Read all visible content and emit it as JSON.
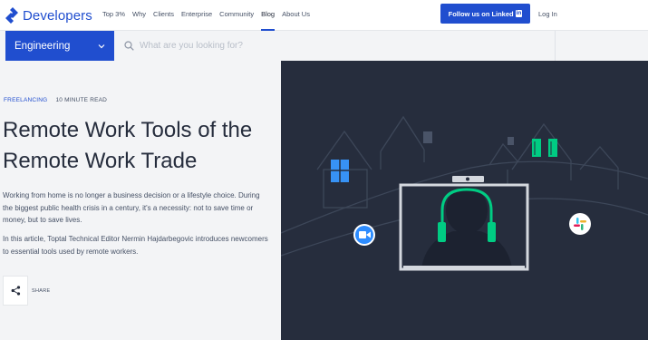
{
  "brand": {
    "name": "Developers",
    "color": "#204ecf"
  },
  "nav": {
    "links": [
      "Top 3%",
      "Why",
      "Clients",
      "Enterprise",
      "Community",
      "Blog",
      "About Us"
    ],
    "active": "Blog",
    "linkedin_label": "Follow us on",
    "linkedin_badge": "in",
    "linkedin_word": "Linked",
    "login_label": "Log In"
  },
  "search": {
    "category": "Engineering",
    "placeholder": "What are you looking for?",
    "value": ""
  },
  "article": {
    "category": "FREELANCING",
    "read_time": "10 MINUTE READ",
    "title": "Remote Work Tools of the Remote Work Trade",
    "lead": "Working from home is no longer a business decision or a lifestyle choice. During the biggest public health crisis in a century, it's a necessity: not to save time or money, but to save lives.",
    "intro": "In this article, Toptal Technical Editor Nermin Hajdarbegovic introduces newcomers to essential tools used by remote workers.",
    "share_label": "SHARE"
  },
  "hero": {
    "background": "#262d3d",
    "line_color": "#3d4759",
    "accent_green": "#00cc83",
    "window_blue": "#3792f5",
    "icons": [
      "video-call-icon",
      "slack-icon",
      "headphones-icon"
    ]
  }
}
